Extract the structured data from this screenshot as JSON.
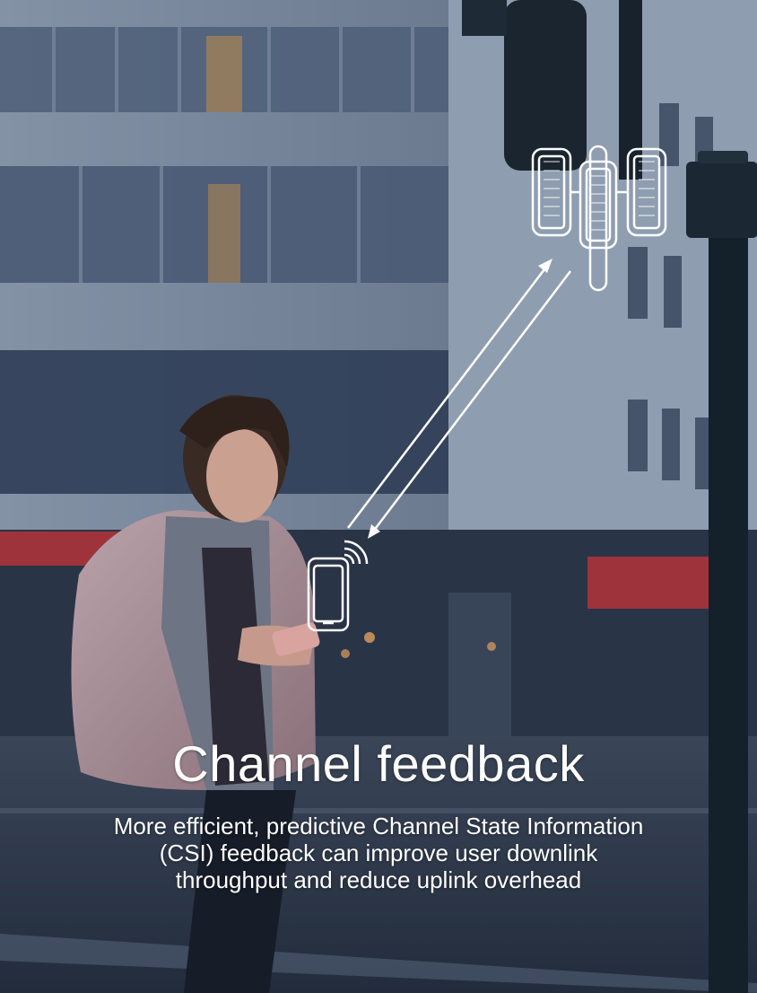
{
  "slide": {
    "title": "Channel feedback",
    "description": "More efficient, predictive Channel State Information (CSI) feedback can improve user downlink throughput and reduce uplink overhead"
  },
  "icons": {
    "device": "smartphone-icon",
    "signal": "wifi-signal-icon",
    "tower": "cell-tower-antenna-icon",
    "links": "bidirectional-arrows-icon"
  },
  "colors": {
    "overlay_text": "#ffffff",
    "icon_stroke": "#ffffff",
    "pole": "#14202a",
    "awning": "#b3343a"
  }
}
